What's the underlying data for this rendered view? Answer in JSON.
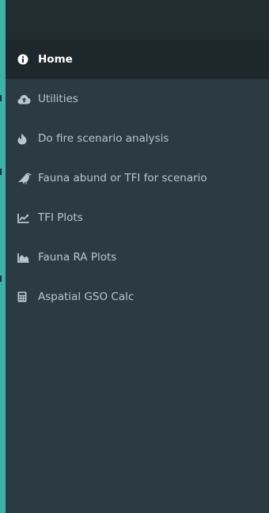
{
  "colors": {
    "accent": "#3bb3a9",
    "sidebar_bg": "#2c3b41",
    "sidebar_header_bg": "#222d32",
    "active_bg": "#1e282c",
    "text": "#b8c7ce",
    "active_text": "#ffffff"
  },
  "sidebar": {
    "active_index": 0,
    "items": [
      {
        "label": "Home",
        "icon": "info-circle-icon"
      },
      {
        "label": "Utilities",
        "icon": "cloud-upload-icon"
      },
      {
        "label": "Do fire scenario analysis",
        "icon": "fire-icon"
      },
      {
        "label": "Fauna abund or TFI for scenario",
        "icon": "crow-icon"
      },
      {
        "label": "TFI Plots",
        "icon": "line-chart-icon"
      },
      {
        "label": "Fauna RA Plots",
        "icon": "area-chart-icon"
      },
      {
        "label": "Aspatial GSO Calc",
        "icon": "calculator-icon"
      }
    ]
  }
}
